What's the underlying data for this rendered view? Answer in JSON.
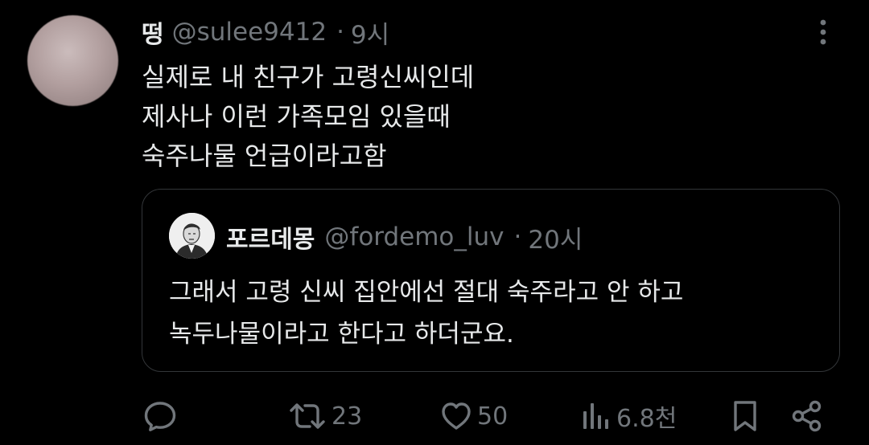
{
  "tweet": {
    "author_name": "떵",
    "author_handle": "@sulee9412",
    "separator": "·",
    "time": "9시",
    "text_lines": [
      "실제로 내 친구가 고령신씨인데",
      "제사나 이런 가족모임 있을때",
      "숙주나물 언급이라고함"
    ]
  },
  "quote": {
    "author_name": "포르데몽",
    "author_handle": "@fordemo_luv",
    "separator": "·",
    "time": "20시",
    "text_lines": [
      "그래서 고령 신씨 집안에선 절대 숙주라고 안 하고",
      "녹두나물이라고 한다고 하더군요."
    ]
  },
  "actions": {
    "reply_icon": "speech-bubble-icon",
    "retweet_icon": "retweet-arrows-icon",
    "retweet_count": "23",
    "like_icon": "heart-icon",
    "like_count": "50",
    "views_icon": "bar-chart-icon",
    "views_count": "6.8천",
    "bookmark_icon": "bookmark-icon",
    "share_icon": "share-nodes-icon"
  },
  "colors": {
    "background": "#000000",
    "text": "#e7e9ea",
    "muted": "#71767b",
    "border": "#333639"
  }
}
